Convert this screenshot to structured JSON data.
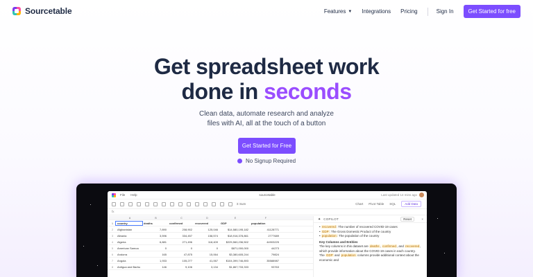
{
  "nav": {
    "brand": "Sourcetable",
    "links": [
      "Features",
      "Integrations",
      "Pricing"
    ],
    "sign_in": "Sign In",
    "cta": "Get Started for free"
  },
  "hero": {
    "title_line1": "Get spreadsheet work",
    "title_line2_prefix": "done in ",
    "title_line2_accent": "seconds",
    "subtitle_line1": "Clean data, automate research and analyze",
    "subtitle_line2": "files with AI, all at the touch of a button",
    "cta": "Get Started for Free",
    "no_signup": "No Signup Required"
  },
  "app": {
    "menu": [
      "File",
      "Help"
    ],
    "doc_name": "sourcetable",
    "last_updated": "Last updated 14 mins ago",
    "toolbar_right": [
      "Σ Sum",
      "Chart",
      "Pivot Table",
      "SQL"
    ],
    "add_data": "Add Data",
    "formula_ref": "fx",
    "columns": [
      "",
      "A",
      "B",
      "C",
      "D",
      "E",
      "F"
    ],
    "header_row": [
      "1",
      "country",
      "deaths",
      "confirmed",
      "recovered",
      "GDP",
      "population"
    ],
    "rows": [
      [
        "2",
        "Afghanistan",
        "7,890",
        "208,902",
        "125,046",
        "$14,580,195,182",
        "41128771"
      ],
      [
        "3",
        "Albania",
        "3,596",
        "334,457",
        "158,574",
        "$18,916,378,861",
        "2777689"
      ],
      [
        "4",
        "Algeria",
        "6,881",
        "271,496",
        "118,409",
        "$225,560,236,502",
        "44903225"
      ],
      [
        "5",
        "American Samoa",
        "0",
        "0",
        "0",
        "$871,000,000",
        "44273"
      ],
      [
        "6",
        "Andorra",
        "165",
        "47,875",
        "15,064",
        "$3,380,605,244",
        "79824"
      ],
      [
        "7",
        "Angola",
        "1,933",
        "105,277",
        "41,067",
        "$104,399,746,893",
        "35588987"
      ],
      [
        "8",
        "Antigua and Barbu",
        "146",
        "9,106",
        "3,134",
        "$1,867,733,333",
        "93763"
      ]
    ],
    "copilot": {
      "label": "COPILOT",
      "reset": "Reset",
      "close": "×",
      "bullets": [
        {
          "code": "recovered",
          "text": ": The number of recovered COVID-19 cases"
        },
        {
          "code": "GDP",
          "text": ": The Gross Domestic Product of the country"
        },
        {
          "code": "population",
          "text": ": The population of the country"
        }
      ],
      "heading": "Key Columns and Entities",
      "para_prefix": "The key columns in this dataset are ",
      "para_code1": "deaths",
      "para_sep": ", ",
      "para_code2": "confirmed",
      "para_mid": ", and",
      "para_code3": "recovered",
      "para_mid2": ", which provide information about the COVID-19 cases in each country. The ",
      "para_code4": "GDP",
      "para_and": " and ",
      "para_code5": "population",
      "para_end": " columns provide additional context about the economic and"
    }
  }
}
